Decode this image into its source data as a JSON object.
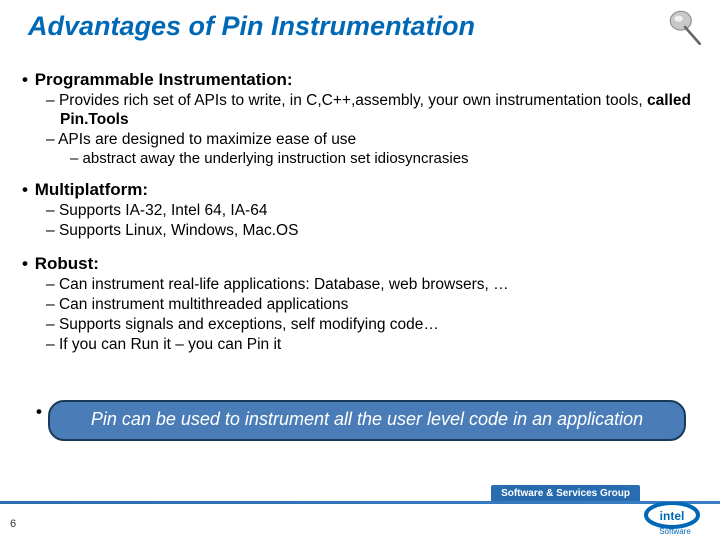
{
  "title": "Advantages of Pin Instrumentation",
  "sections": [
    {
      "heading": "Programmable Instrumentation:",
      "items": [
        {
          "pre": "Provides rich set of APIs to write, in C,C++,assembly, your own instrumentation tools, ",
          "bold": "called Pin.Tools",
          "post": ""
        },
        {
          "pre": "APIs are designed to maximize ease of use",
          "sub": [
            "abstract away the underlying instruction set idiosyncrasies"
          ]
        }
      ]
    },
    {
      "heading": "Multiplatform:",
      "items": [
        {
          "pre": "Supports IA-32, Intel 64, IA-64"
        },
        {
          "pre": "Supports Linux, Windows, Mac.OS"
        }
      ]
    },
    {
      "heading": "Robust:",
      "items": [
        {
          "pre": "Can instrument real-life applications: Database, web browsers, …"
        },
        {
          "pre": "Can instrument multithreaded applications"
        },
        {
          "pre": "Supports signals and exceptions, self modifying code…"
        },
        {
          "pre": "If you can Run it – you can Pin it"
        }
      ]
    }
  ],
  "highlight": "Pin can be used to instrument all the user level code in an application",
  "footer_text": "Software & Services Group",
  "page_num": "6",
  "logo_label": "intel",
  "logo_sub": "Software"
}
